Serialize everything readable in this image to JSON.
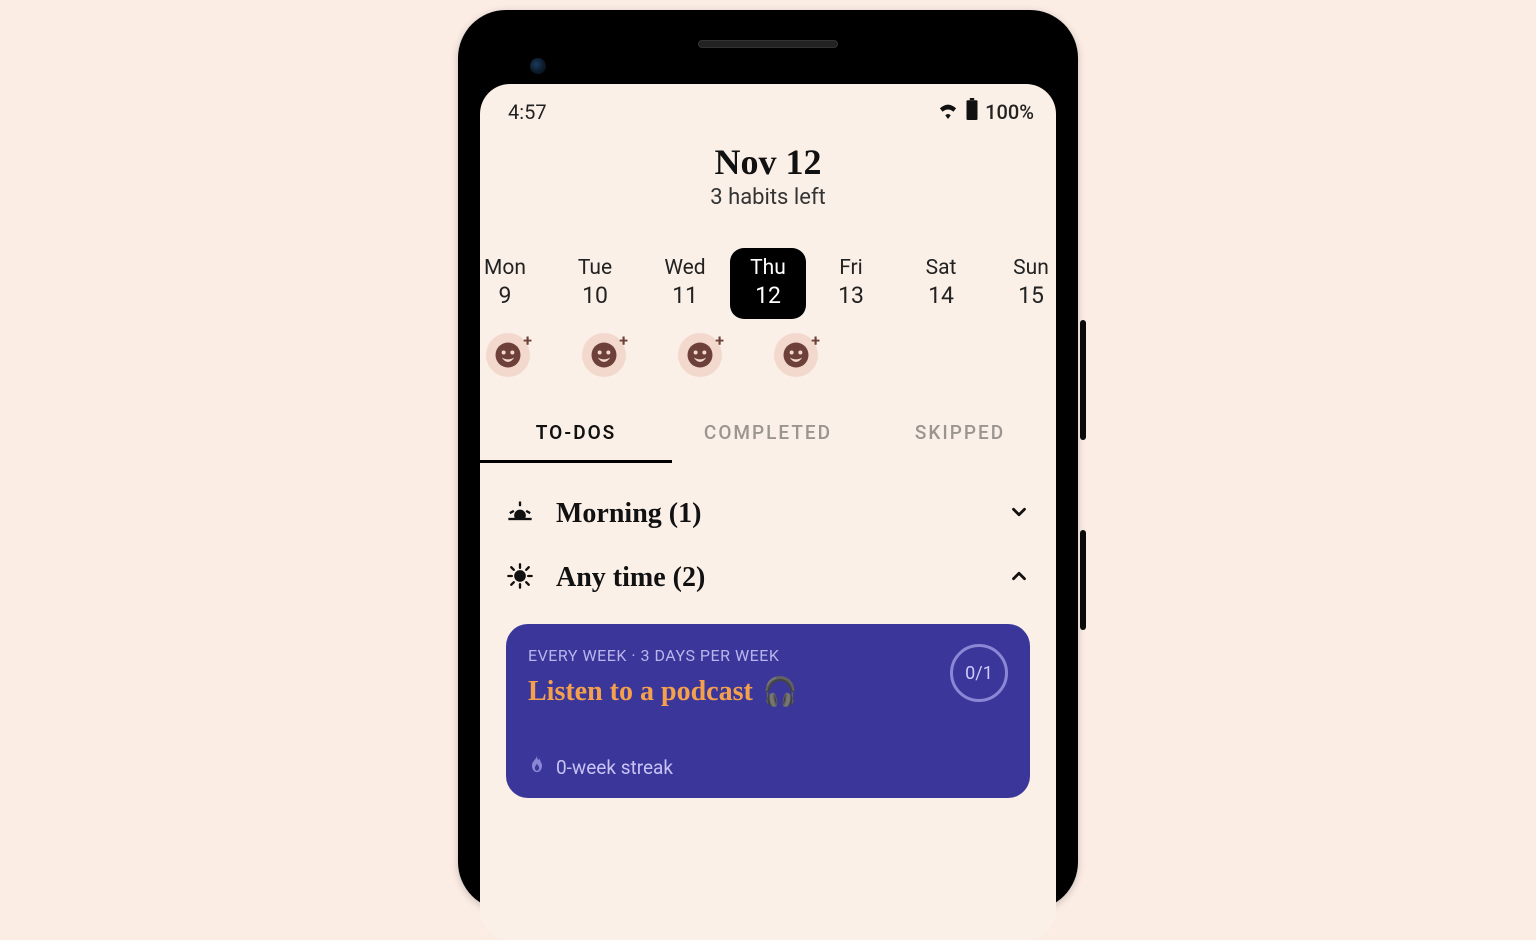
{
  "status": {
    "time": "4:57",
    "battery": "100%"
  },
  "header": {
    "date": "Nov 12",
    "subtitle": "3 habits left"
  },
  "week": [
    {
      "dow": "Mon",
      "num": "9",
      "selected": false,
      "mood": true
    },
    {
      "dow": "Tue",
      "num": "10",
      "selected": false,
      "mood": true
    },
    {
      "dow": "Wed",
      "num": "11",
      "selected": false,
      "mood": true
    },
    {
      "dow": "Thu",
      "num": "12",
      "selected": true,
      "mood": true
    },
    {
      "dow": "Fri",
      "num": "13",
      "selected": false,
      "mood": false
    },
    {
      "dow": "Sat",
      "num": "14",
      "selected": false,
      "mood": false
    },
    {
      "dow": "Sun",
      "num": "15",
      "selected": false,
      "mood": false
    }
  ],
  "tabs": {
    "todos": "TO-DOS",
    "completed": "COMPLETED",
    "skipped": "SKIPPED"
  },
  "sections": {
    "morning": "Morning (1)",
    "anytime": "Any time (2)"
  },
  "habit": {
    "meta": "EVERY WEEK · 3 DAYS PER WEEK",
    "title": "Listen to a podcast",
    "emoji": "🎧",
    "progress": "0/1",
    "streak": "0-week streak"
  }
}
